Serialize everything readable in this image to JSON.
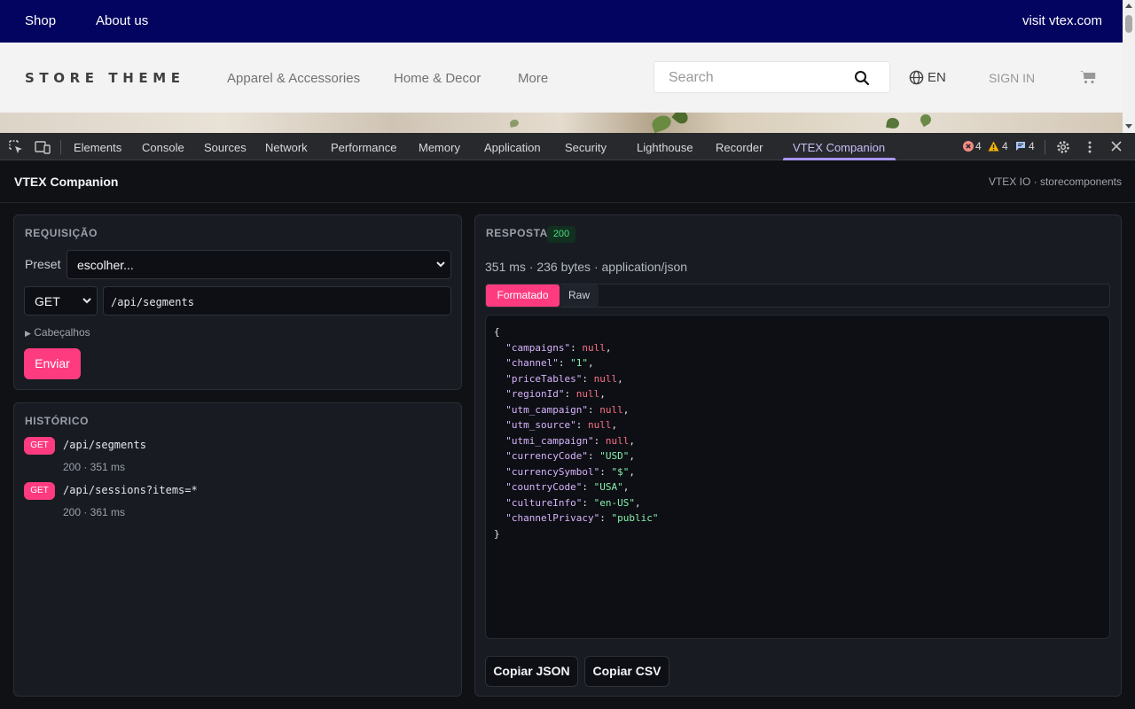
{
  "store": {
    "topbar": {
      "shop": "Shop",
      "about": "About us",
      "visit": "visit vtex.com"
    },
    "logo": "STORE THEME",
    "nav": [
      "Apparel & Accessories",
      "Home & Decor",
      "More"
    ],
    "search_placeholder": "Search",
    "language": "EN",
    "sign_in": "SIGN IN"
  },
  "devtools": {
    "tabs": [
      "Elements",
      "Console",
      "Sources",
      "Network",
      "Performance",
      "Memory",
      "Application",
      "Security",
      "Lighthouse",
      "Recorder",
      "VTEX Companion"
    ],
    "active_tab": "VTEX Companion",
    "errors": "4",
    "warnings": "4",
    "messages": "4"
  },
  "panel": {
    "title": "VTEX Companion",
    "subtitle": "VTEX IO · storecomponents"
  },
  "request": {
    "title": "REQUISIÇÃO",
    "preset_label": "Preset",
    "preset_value": "escolher...",
    "method": "GET",
    "path": "/api/segments",
    "headers_toggle": "Cabeçalhos",
    "send": "Enviar"
  },
  "history": {
    "title": "HISTÓRICO",
    "items": [
      {
        "method": "GET",
        "path": "/api/segments",
        "meta": "200 · 351 ms"
      },
      {
        "method": "GET",
        "path": "/api/sessions?items=*",
        "meta": "200 · 361 ms"
      }
    ]
  },
  "response": {
    "title": "RESPOSTA",
    "status": "200",
    "meta": "351 ms · 236 bytes · application/json",
    "tab_formatted": "Formatado",
    "tab_raw": "Raw",
    "json_lines": [
      {
        "key": "campaigns",
        "value": "null",
        "type": "null"
      },
      {
        "key": "channel",
        "value": "\"1\"",
        "type": "str"
      },
      {
        "key": "priceTables",
        "value": "null",
        "type": "null"
      },
      {
        "key": "regionId",
        "value": "null",
        "type": "null"
      },
      {
        "key": "utm_campaign",
        "value": "null",
        "type": "null"
      },
      {
        "key": "utm_source",
        "value": "null",
        "type": "null"
      },
      {
        "key": "utmi_campaign",
        "value": "null",
        "type": "null"
      },
      {
        "key": "currencyCode",
        "value": "\"USD\"",
        "type": "str"
      },
      {
        "key": "currencySymbol",
        "value": "\"$\"",
        "type": "str"
      },
      {
        "key": "countryCode",
        "value": "\"USA\"",
        "type": "str"
      },
      {
        "key": "cultureInfo",
        "value": "\"en-US\"",
        "type": "str"
      },
      {
        "key": "channelPrivacy",
        "value": "\"public\"",
        "type": "str"
      }
    ],
    "copy_json": "Copiar JSON",
    "copy_csv": "Copiar CSV"
  },
  "colors": {
    "accent": "#ff3b7f",
    "devtools_active": "#a797f3",
    "status_ok": "#4ade80",
    "store_topbar": "#030360"
  }
}
